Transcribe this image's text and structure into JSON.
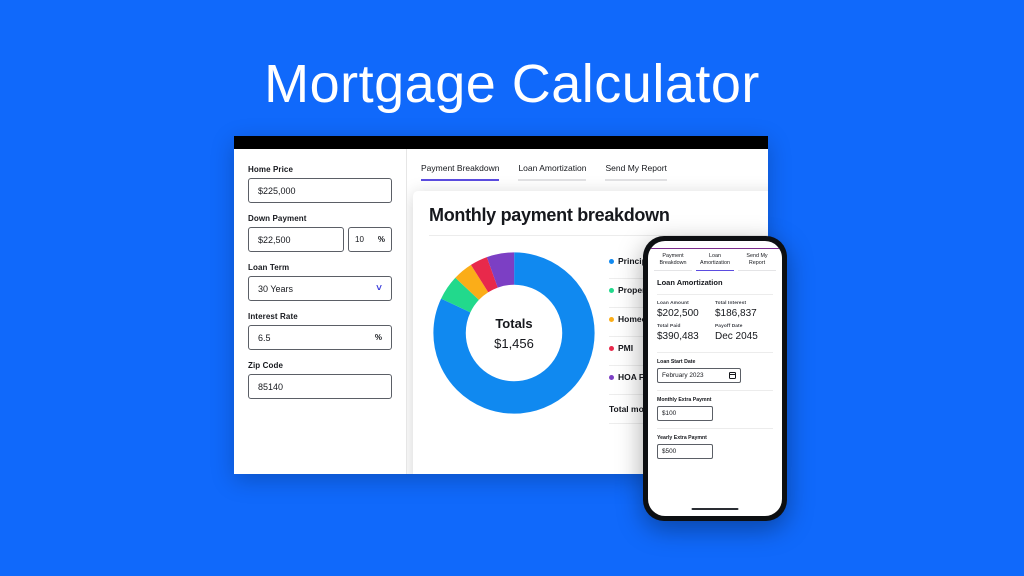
{
  "page": {
    "title": "Mortgage Calculator",
    "background_color": "#1069fb"
  },
  "desktop": {
    "form": {
      "fields": [
        {
          "label": "Home Price",
          "value": "$225,000"
        },
        {
          "label": "Down Payment",
          "value": "$22,500",
          "pct_value": "10",
          "pct_unit": "%"
        },
        {
          "label": "Loan Term",
          "value": "30 Years",
          "icon": "chevron-down-icon"
        },
        {
          "label": "Interest Rate",
          "value": "6.5",
          "unit": "%"
        },
        {
          "label": "Zip Code",
          "value": "85140"
        }
      ]
    },
    "tabs": [
      {
        "label": "Payment Breakdown",
        "active": true
      },
      {
        "label": "Loan Amortization",
        "active": false
      },
      {
        "label": "Send My Report",
        "active": false
      }
    ],
    "result_title": "Monthly payment breakdown",
    "donut_center_label": "Totals",
    "donut_center_value": "$1,456",
    "legend": [
      {
        "label": "Principle",
        "color": "#1089f0"
      },
      {
        "label": "Property",
        "color": "#22d98c"
      },
      {
        "label": "Homeowner insurance",
        "color": "#fbad18"
      },
      {
        "label": "PMI",
        "color": "#e8294b"
      },
      {
        "label": "HOA Fees",
        "color": "#7c3fc4"
      },
      {
        "label": "Total monthly",
        "color": null
      }
    ]
  },
  "chart_data": {
    "type": "pie",
    "title": "Monthly payment breakdown",
    "center_label": "Totals",
    "center_value": "$1,456",
    "total": 1456,
    "categories": [
      "Principle",
      "Property",
      "Homeowner insurance",
      "PMI",
      "HOA Fees"
    ],
    "values": [
      82,
      5,
      4,
      3.5,
      5.5
    ],
    "unit": "percent",
    "colors": [
      "#1089f0",
      "#22d98c",
      "#fbad18",
      "#e8294b",
      "#7c3fc4"
    ],
    "legend_position": "right",
    "grid": false
  },
  "phone": {
    "tabs": [
      {
        "line1": "Payment",
        "line2": "Breakdown",
        "active": false
      },
      {
        "line1": "Loan",
        "line2": "Amortization",
        "active": true
      },
      {
        "line1": "Send My",
        "line2": "Report",
        "active": false
      }
    ],
    "heading": "Loan Amortization",
    "stats": [
      {
        "label": "Loan Amount",
        "value": "$202,500"
      },
      {
        "label": "Total Interest",
        "value": "$186,837"
      },
      {
        "label": "Total Paid",
        "value": "$390,483"
      },
      {
        "label": "Payoff Date",
        "value": "Dec 2045"
      }
    ],
    "fields": [
      {
        "label": "Loan Start Date",
        "value": "February 2023",
        "icon": "calendar-icon"
      },
      {
        "label": "Monthly Extra Paymnt",
        "value": "$100"
      },
      {
        "label": "Yearly Extra Paymnt",
        "value": "$500"
      }
    ]
  }
}
